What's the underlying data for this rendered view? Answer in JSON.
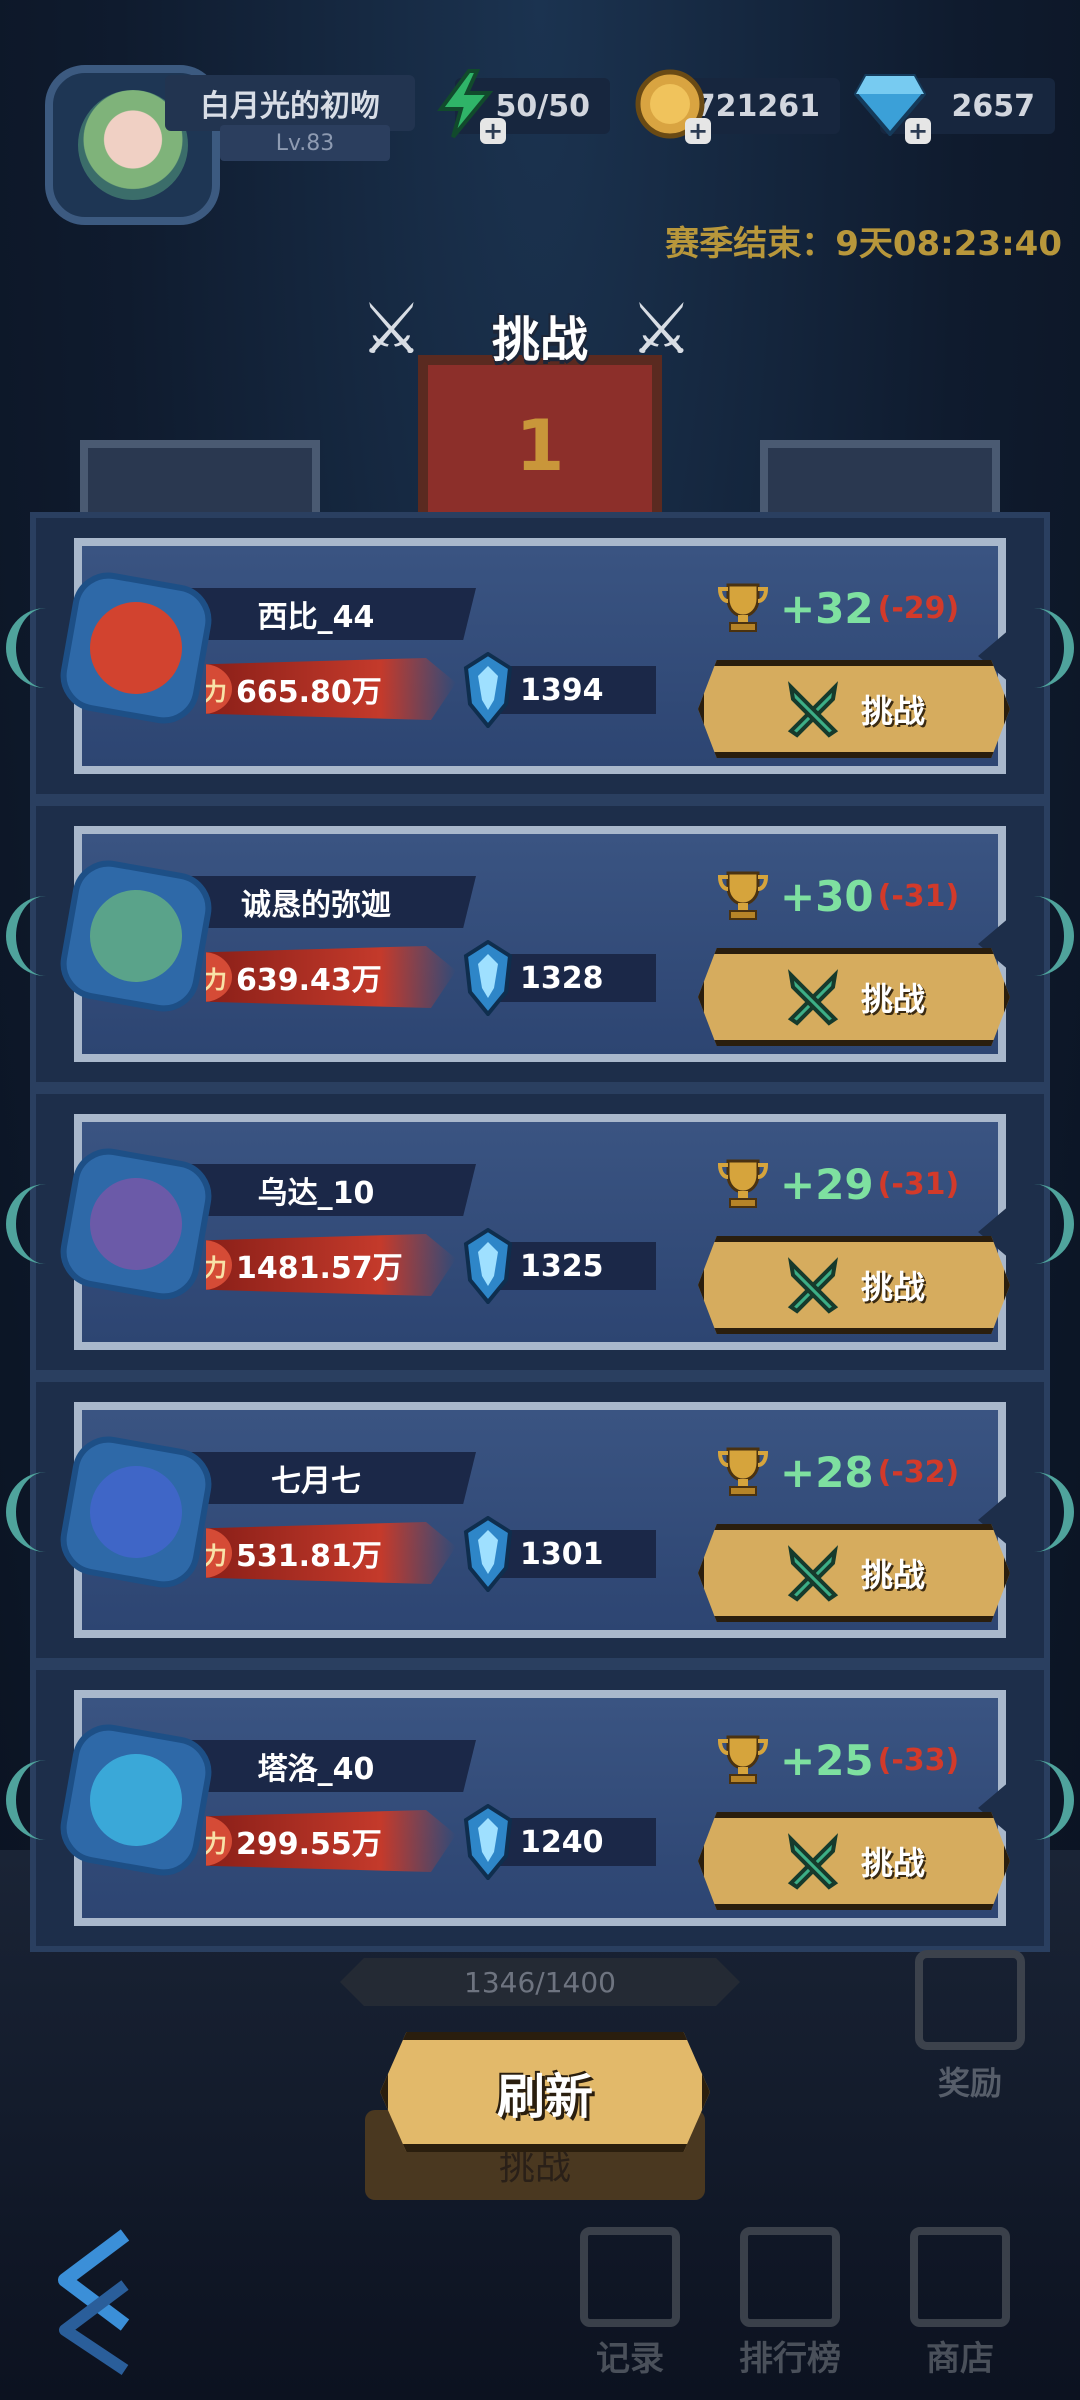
{
  "player": {
    "name": "白月光的初吻",
    "level": "Lv.83"
  },
  "resources": {
    "energy": "50/50",
    "gold": "6721261",
    "gems": "2657"
  },
  "season_end": "赛季结束：9天08:23:40",
  "title": "挑战",
  "banner_rank": "1",
  "opponents": [
    {
      "name": "西比_44",
      "power": "665.80万",
      "power_tag": "战力",
      "rank": "1394",
      "gain": "+32",
      "loss": "(-29)",
      "button": "挑战",
      "avatar_color": "#d2432f"
    },
    {
      "name": "诚恳的弥迦",
      "power": "639.43万",
      "power_tag": "战力",
      "rank": "1328",
      "gain": "+30",
      "loss": "(-31)",
      "button": "挑战",
      "avatar_color": "#5aa38a"
    },
    {
      "name": "乌达_10",
      "power": "1481.57万",
      "power_tag": "战力",
      "rank": "1325",
      "gain": "+29",
      "loss": "(-31)",
      "button": "挑战",
      "avatar_color": "#6b5aa8"
    },
    {
      "name": "七月七",
      "power": "531.81万",
      "power_tag": "战力",
      "rank": "1301",
      "gain": "+28",
      "loss": "(-32)",
      "button": "挑战",
      "avatar_color": "#3f66c7"
    },
    {
      "name": "塔洛_40",
      "power": "299.55万",
      "power_tag": "战力",
      "rank": "1240",
      "gain": "+25",
      "loss": "(-33)",
      "button": "挑战",
      "avatar_color": "#3aa8d8"
    }
  ],
  "progress": "1346/1400",
  "refresh_label": "刷新",
  "refresh_under_label": "挑战",
  "reward_label": "奖励",
  "nav": {
    "record": "记录",
    "leaderboard": "排行榜",
    "shop": "商店"
  },
  "colors": {
    "gain": "#7ee0a0",
    "loss": "#d23a2a",
    "season": "#b8973b",
    "button": "#d6ac5e"
  }
}
